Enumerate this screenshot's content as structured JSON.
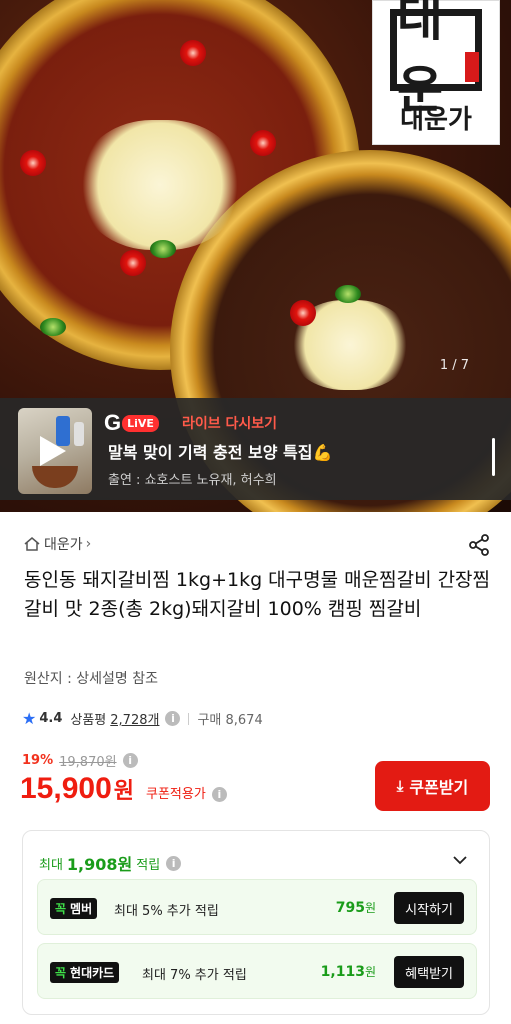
{
  "hero": {
    "brand_logo_glyph": "대운",
    "brand_logo_name": "대운가",
    "image_counter": "1 / 7"
  },
  "live": {
    "g_letter": "G",
    "live_badge": "LiVE",
    "replay_label": "라이브 다시보기",
    "title": "말복 맞이 기력 충전 보양 특집",
    "title_emoji": "💪",
    "cast": "출연 : 쇼호스트 노유재, 허수희"
  },
  "product": {
    "store_name": "대운가",
    "title": "동인동 돼지갈비찜 1kg+1kg 대구명물 매운찜갈비 간장찜갈비 맛 2종(총 2kg)돼지갈비 100% 캠핑 찜갈비",
    "origin": "원산지 : 상세설명 참조"
  },
  "rating": {
    "score": "4.4",
    "review_label": "상품평",
    "review_count": "2,728개",
    "purchase_label": "구매 8,674"
  },
  "price": {
    "discount": "19%",
    "original": "19,870원",
    "current": "15,900",
    "unit": "원",
    "coupon_applied": "쿠폰적용가",
    "coupon_button": "쿠폰받기"
  },
  "reward": {
    "prefix": "최대",
    "amount": "1,908원",
    "suffix": "적립",
    "cards": [
      {
        "brand": "꼭",
        "kind": "멤버",
        "desc": "최대 5% 추가 적립",
        "points": "795",
        "points_unit": "원",
        "action": "시작하기"
      },
      {
        "brand": "꼭",
        "kind": "현대카드",
        "desc": "최대 7% 추가 적립",
        "points": "1,113",
        "points_unit": "원",
        "action": "혜택받기"
      }
    ]
  },
  "colors": {
    "accent_red": "#ef1d10",
    "reward_green": "#1a9c1a",
    "rating_star": "#2b6ef5"
  }
}
